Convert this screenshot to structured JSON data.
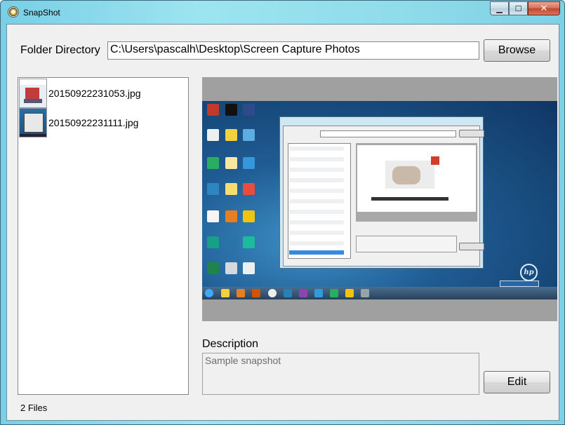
{
  "window": {
    "title": "SnapShot",
    "controls": {
      "minimize": "▁",
      "maximize": "☐",
      "close": "✕"
    }
  },
  "folder": {
    "label": "Folder Directory",
    "path": "C:\\Users\\pascalh\\Desktop\\Screen Capture Photos",
    "browse_label": "Browse"
  },
  "files": {
    "items": [
      {
        "name": "20150922231053.jpg",
        "thumbnail_icon": "image-thumbnail-icon"
      },
      {
        "name": "20150922231111.jpg",
        "thumbnail_icon": "image-thumbnail-icon"
      }
    ],
    "count_label": "2 Files"
  },
  "preview": {
    "content": "screenshot-image"
  },
  "description": {
    "label": "Description",
    "value": "Sample snapshot"
  },
  "edit_label": "Edit",
  "colors": {
    "title_gradient_start": "#78cfe6",
    "client_bg": "#f0f0f0",
    "close_button": "#c2432a"
  }
}
